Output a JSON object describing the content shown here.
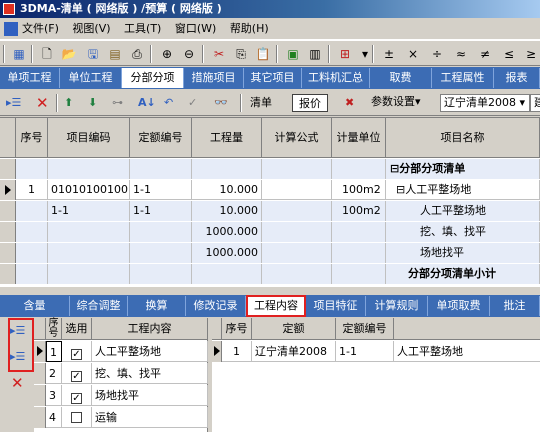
{
  "window": {
    "title": "3DMA-清单 ( 网络版 ) /预算 ( 网络版 )"
  },
  "menu": [
    "文件(F)",
    "视图(V)",
    "工具(T)",
    "窗口(W)",
    "帮助(H)"
  ],
  "toolbar": {
    "symbols": [
      "±",
      "×",
      "÷",
      "≈",
      "≠",
      "≤",
      "≥"
    ]
  },
  "top_tabs": [
    "单项工程",
    "单位工程",
    "分部分项",
    "措施项目",
    "其它项目",
    "工料机汇总",
    "取费",
    "工程属性",
    "报表"
  ],
  "top_tabs_active": "分部分项",
  "subtoolbar": {
    "qingdan_label": "清单",
    "baojia_label": "报价",
    "settings_label": "参数设置",
    "quota_combo": "辽宁清单2008",
    "extra_combo": "建"
  },
  "grid": {
    "headers": [
      "序号",
      "项目编码",
      "定额编号",
      "工程量",
      "计算公式",
      "计量单位",
      "项目名称"
    ],
    "rows": [
      {
        "seq": "",
        "code": "",
        "quota": "",
        "qty": "",
        "formula": "",
        "unit": "",
        "name": "⊟分部分项清单",
        "bold": true
      },
      {
        "seq": "1",
        "code": "010101001001",
        "quota": "1-1",
        "qty": "10.000",
        "formula": "",
        "unit": "100m2",
        "name": "⊟人工平整场地"
      },
      {
        "seq": "",
        "code": "1-1",
        "quota": "1-1",
        "qty": "10.000",
        "formula": "",
        "unit": "100m2",
        "name": "人工平整场地"
      },
      {
        "seq": "",
        "code": "",
        "quota": "",
        "qty": "1000.000",
        "formula": "",
        "unit": "",
        "name": "挖、填、找平"
      },
      {
        "seq": "",
        "code": "",
        "quota": "",
        "qty": "1000.000",
        "formula": "",
        "unit": "",
        "name": "场地找平"
      },
      {
        "seq": "",
        "code": "",
        "quota": "",
        "qty": "",
        "formula": "",
        "unit": "",
        "name": "分部分项清单小计",
        "bold": true
      }
    ]
  },
  "bottom_tabs": [
    "含量",
    "综合调整",
    "换算",
    "修改记录",
    "工程内容",
    "项目特征",
    "计算规则",
    "单项取费",
    "批注"
  ],
  "bottom_tabs_active": "工程内容",
  "work_content": {
    "headers": [
      "序号",
      "选用",
      "工程内容"
    ],
    "rows": [
      {
        "seq": "1",
        "checked": true,
        "content": "人工平整场地"
      },
      {
        "seq": "2",
        "checked": true,
        "content": "挖、填、找平"
      },
      {
        "seq": "3",
        "checked": true,
        "content": "场地找平"
      },
      {
        "seq": "4",
        "checked": false,
        "content": "运输"
      }
    ]
  },
  "quota_table": {
    "headers": [
      "序号",
      "定额",
      "定额编号"
    ],
    "rows": [
      {
        "seq": "1",
        "quota": "辽宁清单2008",
        "code": "1-1",
        "name": "人工平整场地"
      }
    ]
  }
}
